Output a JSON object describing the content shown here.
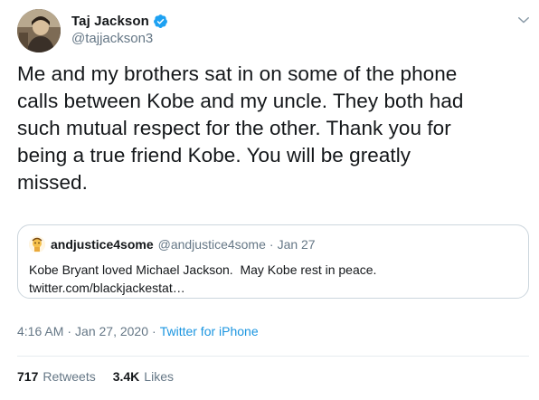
{
  "author": {
    "display_name": "Taj Jackson",
    "handle": "@tajjackson3",
    "verified": true,
    "avatar_icon": "profile-photo-icon"
  },
  "tweet": {
    "lines": [
      "Me and my brothers sat in on some of the phone",
      "calls between Kobe and my uncle. They both had",
      "such mutual respect for the other. Thank you for",
      "being a true friend Kobe. You will be greatly",
      "missed."
    ]
  },
  "quoted_tweet": {
    "display_name": "andjustice4some",
    "handle": "@andjustice4some",
    "separator": "·",
    "date": "Jan 27",
    "lines": [
      "Kobe Bryant loved Michael Jackson.  May Kobe rest in peace.",
      "twitter.com/blackjackestat…"
    ]
  },
  "meta": {
    "time": "4:16 AM",
    "separator": "·",
    "date": "Jan 27, 2020",
    "source": "Twitter for iPhone"
  },
  "stats": {
    "retweets_count": "717",
    "retweets_label": "Retweets",
    "likes_count": "3.4K",
    "likes_label": "Likes"
  },
  "colors": {
    "verified": "#1da1f2",
    "link": "#1b95e0",
    "secondary_text": "#657786",
    "border": "#ccd6dd"
  }
}
